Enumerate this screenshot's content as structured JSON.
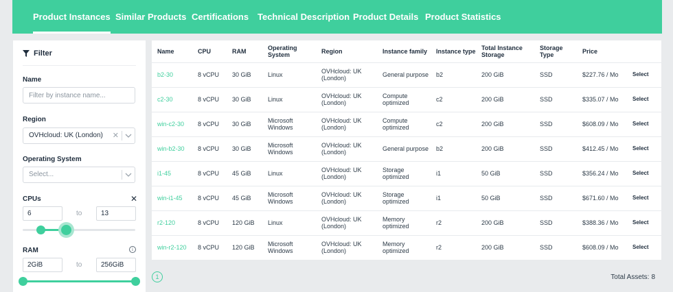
{
  "tabs": [
    "Product Instances",
    "Similar Products",
    "Certifications",
    "Technical Description",
    "Product Details",
    "Product Statistics"
  ],
  "filter": {
    "title": "Filter",
    "icon": "funnel-icon",
    "name_label": "Name",
    "name_placeholder": "Filter by instance name...",
    "region_label": "Region",
    "region_value": "OVHcloud: UK (London)",
    "os_label": "Operating System",
    "os_placeholder": "Select...",
    "cpus_label": "CPUs",
    "cpu_min": "6",
    "cpu_max": "13",
    "ram_label": "RAM",
    "ram_min": "2GiB",
    "ram_max": "256GiB",
    "to": "to"
  },
  "table": {
    "headers": [
      "Name",
      "CPU",
      "RAM",
      "Operating System",
      "Region",
      "Instance family",
      "Instance type",
      "Total Instance Storage",
      "Storage Type",
      "Price",
      ""
    ],
    "rows": [
      [
        "b2-30",
        "8 vCPU",
        "30 GiB",
        "Linux",
        "OVHcloud: UK (London)",
        "General purpose",
        "b2",
        "200 GiB",
        "SSD",
        "$227.76 / Mo",
        "Select"
      ],
      [
        "c2-30",
        "8 vCPU",
        "30 GiB",
        "Linux",
        "OVHcloud: UK (London)",
        "Compute optimized",
        "c2",
        "200 GiB",
        "SSD",
        "$335.07 / Mo",
        "Select"
      ],
      [
        "win-c2-30",
        "8 vCPU",
        "30 GiB",
        "Microsoft Windows",
        "OVHcloud: UK (London)",
        "Compute optimized",
        "c2",
        "200 GiB",
        "SSD",
        "$608.09 / Mo",
        "Select"
      ],
      [
        "win-b2-30",
        "8 vCPU",
        "30 GiB",
        "Microsoft Windows",
        "OVHcloud: UK (London)",
        "General purpose",
        "b2",
        "200 GiB",
        "SSD",
        "$412.45 / Mo",
        "Select"
      ],
      [
        "i1-45",
        "8 vCPU",
        "45 GiB",
        "Linux",
        "OVHcloud: UK (London)",
        "Storage optimized",
        "i1",
        "50 GiB",
        "SSD",
        "$356.24 / Mo",
        "Select"
      ],
      [
        "win-i1-45",
        "8 vCPU",
        "45 GiB",
        "Microsoft Windows",
        "OVHcloud: UK (London)",
        "Storage optimized",
        "i1",
        "50 GiB",
        "SSD",
        "$671.60 / Mo",
        "Select"
      ],
      [
        "r2-120",
        "8 vCPU",
        "120 GiB",
        "Linux",
        "OVHcloud: UK (London)",
        "Memory optimized",
        "r2",
        "200 GiB",
        "SSD",
        "$388.36 / Mo",
        "Select"
      ],
      [
        "win-r2-120",
        "8 vCPU",
        "120 GiB",
        "Microsoft Windows",
        "OVHcloud: UK (London)",
        "Memory optimized",
        "r2",
        "200 GiB",
        "SSD",
        "$608.09 / Mo",
        "Select"
      ]
    ]
  },
  "pagination": {
    "current": "1"
  },
  "total": {
    "label": "Total Assets:",
    "value": "8"
  },
  "colors": {
    "accent": "#3fcf9d",
    "background": "#e9ebed"
  }
}
